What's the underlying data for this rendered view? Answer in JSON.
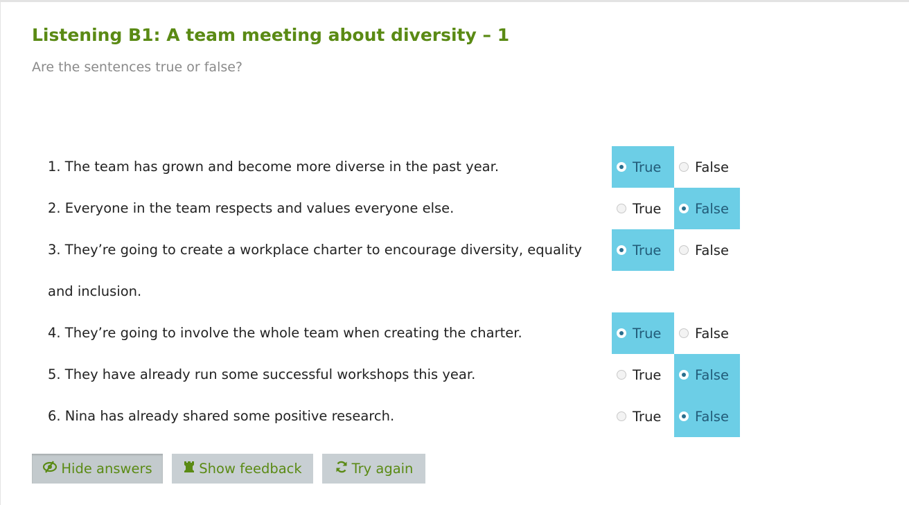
{
  "header": {
    "title": "Listening B1: A team meeting about diversity – 1",
    "instructions": "Are the sentences true or false?"
  },
  "questions": [
    {
      "text": "1. The team has grown and become more diverse in the past year.",
      "true_label": "True",
      "false_label": "False",
      "selected": "true"
    },
    {
      "text": "2. Everyone in the team respects and values everyone else.",
      "true_label": "True",
      "false_label": "False",
      "selected": "false"
    },
    {
      "text": "3. They’re going to create a workplace charter to encourage diversity, equality and inclusion.",
      "true_label": "True",
      "false_label": "False",
      "selected": "true"
    },
    {
      "text": "4. They’re going to involve the whole team when creating the charter.",
      "true_label": "True",
      "false_label": "False",
      "selected": "true"
    },
    {
      "text": "5. They have already run some successful workshops this year.",
      "true_label": "True",
      "false_label": "False",
      "selected": "false"
    },
    {
      "text": "6. Nina has already shared some positive research.",
      "true_label": "True",
      "false_label": "False",
      "selected": "false"
    }
  ],
  "buttons": {
    "hide_answers": "Hide answers",
    "show_feedback": "Show feedback",
    "try_again": "Try again",
    "hide_icon": "eye-slash-icon",
    "feedback_icon": "rook-icon",
    "retry_icon": "refresh-icon"
  },
  "colors": {
    "title": "#5a8a14",
    "selected_bg": "#6ccee6",
    "button_bg": "#c8cfd3"
  }
}
